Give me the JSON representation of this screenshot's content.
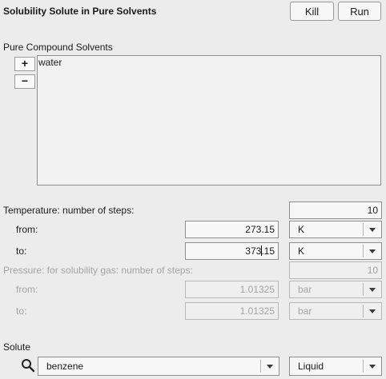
{
  "header": {
    "title": "Solubility Solute in Pure Solvents",
    "kill_label": "Kill",
    "run_label": "Run"
  },
  "solvents": {
    "label": "Pure Compound Solvents",
    "add_label": "+",
    "remove_label": "−",
    "items": [
      "water"
    ]
  },
  "temperature": {
    "steps_label": "Temperature: number of steps:",
    "steps": "10",
    "from_label": "from:",
    "from_value": "273.15",
    "from_unit": "K",
    "to_label": "to:",
    "to_value_before_caret": "373",
    "to_value_after_caret": ".15",
    "to_unit": "K"
  },
  "pressure": {
    "steps_label": "Pressure: for solubility gas: number of steps:",
    "steps": "10",
    "from_label": "from:",
    "from_value": "1.01325",
    "from_unit": "bar",
    "to_label": "to:",
    "to_value": "1.01325",
    "to_unit": "bar"
  },
  "solute": {
    "label": "Solute",
    "search_icon": "search-icon",
    "value": "benzene",
    "phase": "Liquid"
  }
}
